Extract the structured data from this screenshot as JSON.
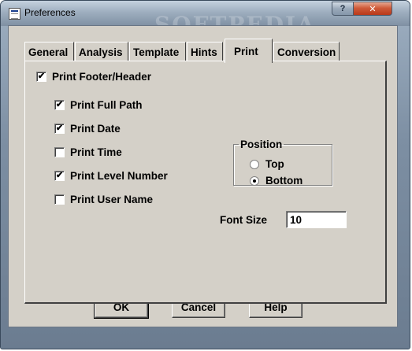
{
  "window": {
    "title": "Preferences",
    "watermark": "SOFTPEDIA",
    "help_button": "?",
    "close_button": "✕"
  },
  "tabs": [
    {
      "label": "General",
      "active": false
    },
    {
      "label": "Analysis",
      "active": false
    },
    {
      "label": "Template",
      "active": false
    },
    {
      "label": "Hints",
      "active": false
    },
    {
      "label": "Print",
      "active": true
    },
    {
      "label": "Conversion",
      "active": false
    }
  ],
  "print": {
    "footer_header": {
      "label": "Print Footer/Header",
      "checked": true
    },
    "options": [
      {
        "label": "Print Full Path",
        "checked": true
      },
      {
        "label": "Print Date",
        "checked": true
      },
      {
        "label": "Print Time",
        "checked": false
      },
      {
        "label": "Print Level Number",
        "checked": true
      },
      {
        "label": "Print User Name",
        "checked": false
      }
    ],
    "position": {
      "label": "Position",
      "options": [
        {
          "label": "Top",
          "selected": false
        },
        {
          "label": "Bottom",
          "selected": true
        }
      ]
    },
    "font_size": {
      "label": "Font Size",
      "value": "10"
    }
  },
  "buttons": {
    "ok": "OK",
    "cancel": "Cancel",
    "help": "Help"
  },
  "colors": {
    "dialog_face": "#d4d0c8",
    "close_button": "#c8452a",
    "title_bar": "#9eaebf"
  },
  "icons": {
    "app": "preferences-app-icon",
    "help": "help-icon",
    "close": "close-icon",
    "check": "checkmark-icon"
  }
}
